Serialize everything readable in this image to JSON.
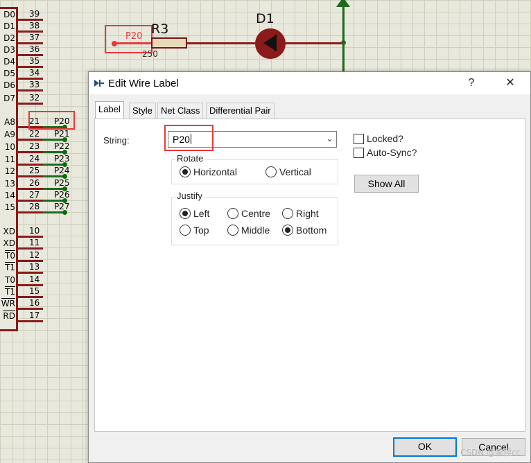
{
  "schematic": {
    "chip_pins": [
      {
        "name": "D0",
        "num": "39",
        "overline": false
      },
      {
        "name": "D1",
        "num": "38",
        "overline": false
      },
      {
        "name": "D2",
        "num": "37",
        "overline": false
      },
      {
        "name": "D3",
        "num": "36",
        "overline": false
      },
      {
        "name": "D4",
        "num": "35",
        "overline": false
      },
      {
        "name": "D5",
        "num": "34",
        "overline": false
      },
      {
        "name": "D6",
        "num": "33",
        "overline": false
      },
      {
        "name": "D7",
        "num": "32",
        "overline": false
      },
      {
        "name": "A8",
        "num": "21",
        "overline": false,
        "label": "P20"
      },
      {
        "name": "A9",
        "num": "22",
        "overline": false,
        "label": "P21"
      },
      {
        "name": "10",
        "num": "23",
        "overline": false,
        "label": "P22"
      },
      {
        "name": "11",
        "num": "24",
        "overline": false,
        "label": "P23"
      },
      {
        "name": "12",
        "num": "25",
        "overline": false,
        "label": "P24"
      },
      {
        "name": "13",
        "num": "26",
        "overline": false,
        "label": "P25"
      },
      {
        "name": "14",
        "num": "27",
        "overline": false,
        "label": "P26"
      },
      {
        "name": "15",
        "num": "28",
        "overline": false,
        "label": "P27"
      },
      {
        "name": "XD",
        "num": "10",
        "overline": false
      },
      {
        "name": "XD",
        "num": "11",
        "overline": false
      },
      {
        "name": "T0",
        "num": "12",
        "overline": true
      },
      {
        "name": "T1",
        "num": "13",
        "overline": true
      },
      {
        "name": "T0",
        "num": "14",
        "overline": false
      },
      {
        "name": "T1",
        "num": "15",
        "overline": true
      },
      {
        "name": "WR",
        "num": "16",
        "overline": true
      },
      {
        "name": "RD",
        "num": "17",
        "overline": true
      }
    ],
    "wire_label": "P20",
    "resistor_ref": "R3",
    "resistor_value": "250",
    "diode_ref": "D1"
  },
  "dialog": {
    "title": "Edit Wire Label",
    "help_glyph": "?",
    "close_glyph": "✕",
    "tabs": [
      "Label",
      "Style",
      "Net Class",
      "Differential Pair"
    ],
    "active_tab": "Label",
    "string_label": "String:",
    "string_value": "P20",
    "rotate_title": "Rotate",
    "rotate_options": [
      "Horizontal",
      "Vertical"
    ],
    "rotate_selected": "Horizontal",
    "justify_title": "Justify",
    "justify_options": [
      "Left",
      "Centre",
      "Right",
      "Top",
      "Middle",
      "Bottom"
    ],
    "justify_selected_horizontal": "Left",
    "justify_selected_vertical": "Bottom",
    "locked_label": "Locked?",
    "autosync_label": "Auto-Sync?",
    "locked_checked": false,
    "autosync_checked": false,
    "show_all_label": "Show All",
    "ok_label": "OK",
    "cancel_label": "Cancel"
  },
  "watermark": "CSDN @李捏cc",
  "colors": {
    "highlight": "#e63a3a",
    "wire_green": "#1e6b1e",
    "chip_red": "#8b1a1a",
    "accent": "#0078d7"
  }
}
